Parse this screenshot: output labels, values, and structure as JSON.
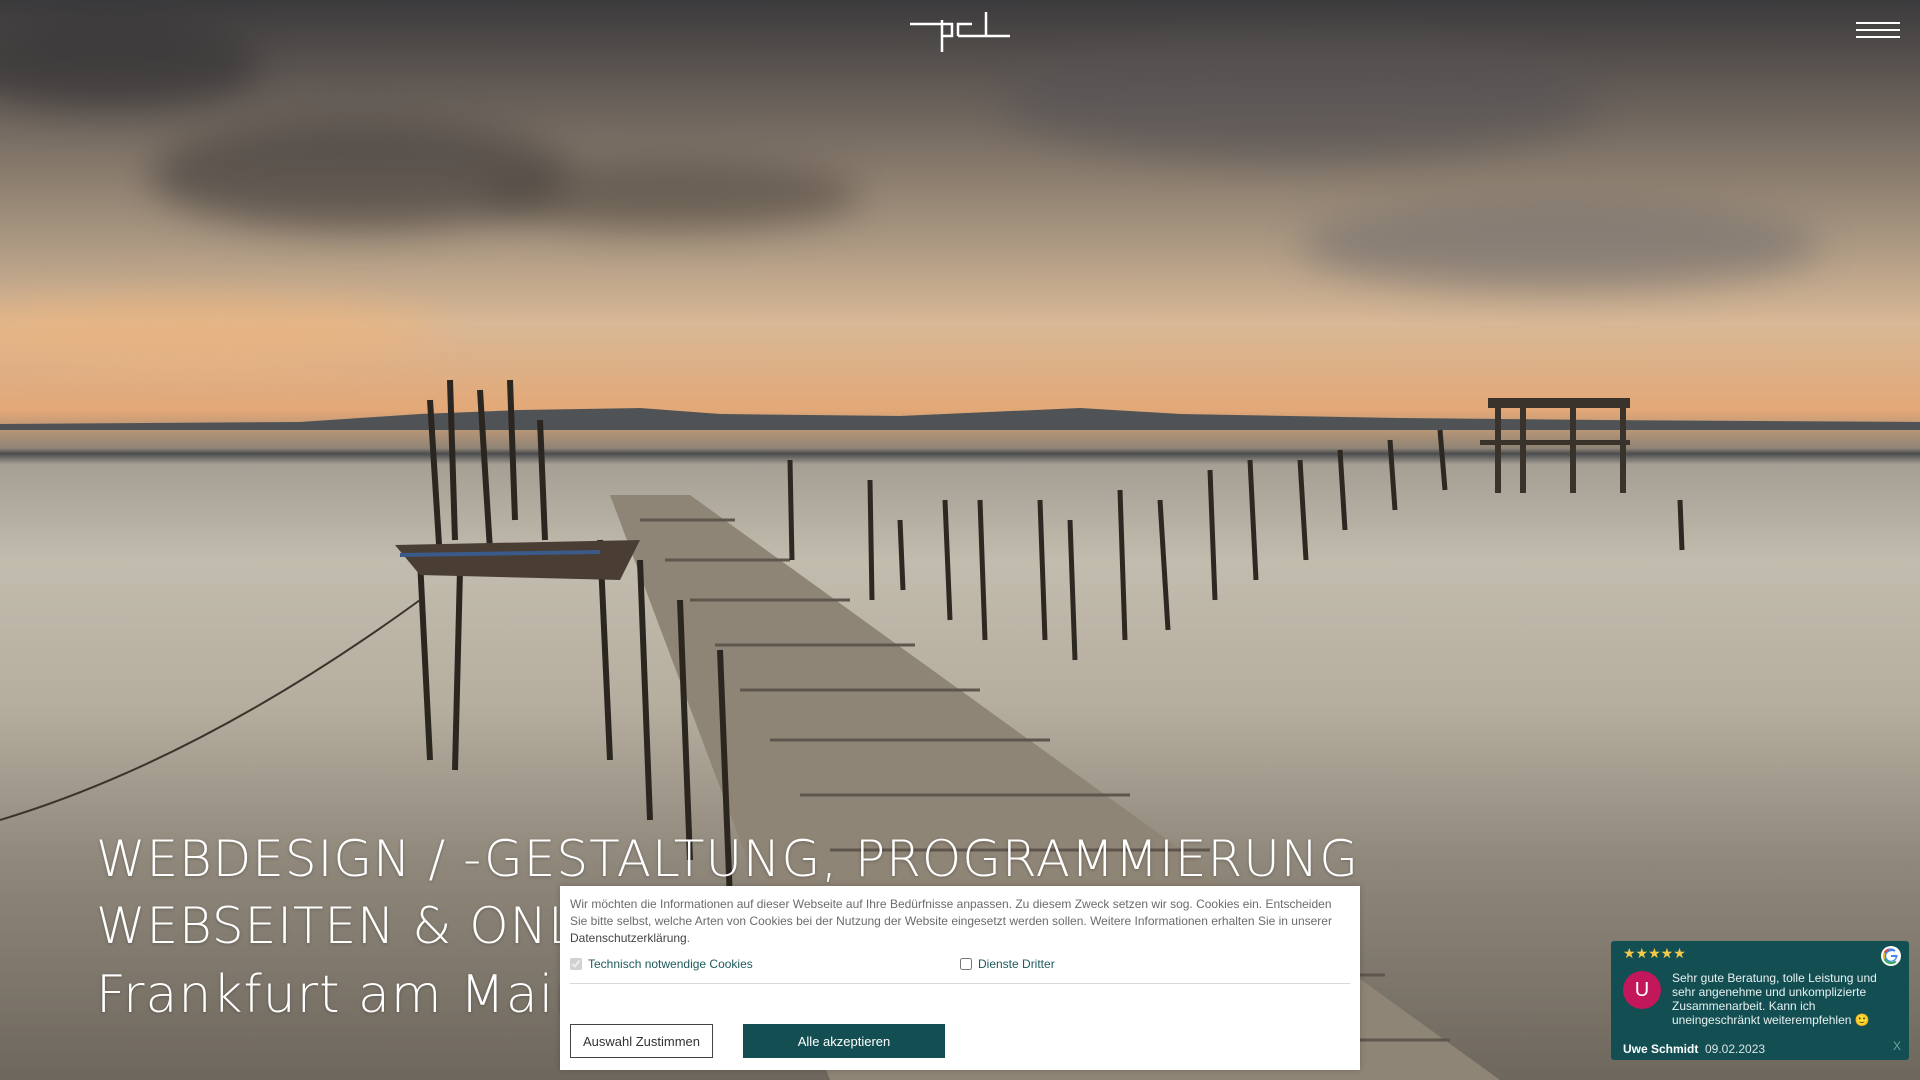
{
  "header": {
    "logo_icon": "pd-logo-icon",
    "menu_icon": "hamburger-menu-icon"
  },
  "hero": {
    "line1": "WEBDESIGN / -GESTALTUNG, PROGRAMMIERUNG",
    "line2": "WEBSEITEN & ONLINE",
    "line3": "Frankfurt am Main"
  },
  "cookie_banner": {
    "text": "Wir möchten die Informationen auf dieser Webseite auf Ihre Bedürfnisse anpassen. Zu diesem Zweck setzen wir sog. Cookies ein. Entscheiden Sie bitte selbst, welche Arten von Cookies bei der Nutzung der Website eingesetzt werden sollen. Weitere Informationen erhalten Sie in unserer ",
    "privacy_link": "Datenschutzerklärung",
    "text_end": ".",
    "option_necessary": "Technisch notwendige Cookies",
    "option_third_party": "Dienste Dritter",
    "btn_select": "Auswahl Zustimmen",
    "btn_accept_all": "Alle akzeptieren"
  },
  "review_widget": {
    "stars": "★★★★★",
    "avatar_letter": "U",
    "message": "Sehr gute Beratung, tolle Leistung und sehr angenehme und unkomplizierte Zusammenarbeit. Kann ich uneingeschränkt weiterempfehlen 🙂",
    "author": "Uwe Schmidt",
    "date": "09.02.2023",
    "close_label": "X",
    "source_icon": "google-icon",
    "accent": "#134f52"
  }
}
